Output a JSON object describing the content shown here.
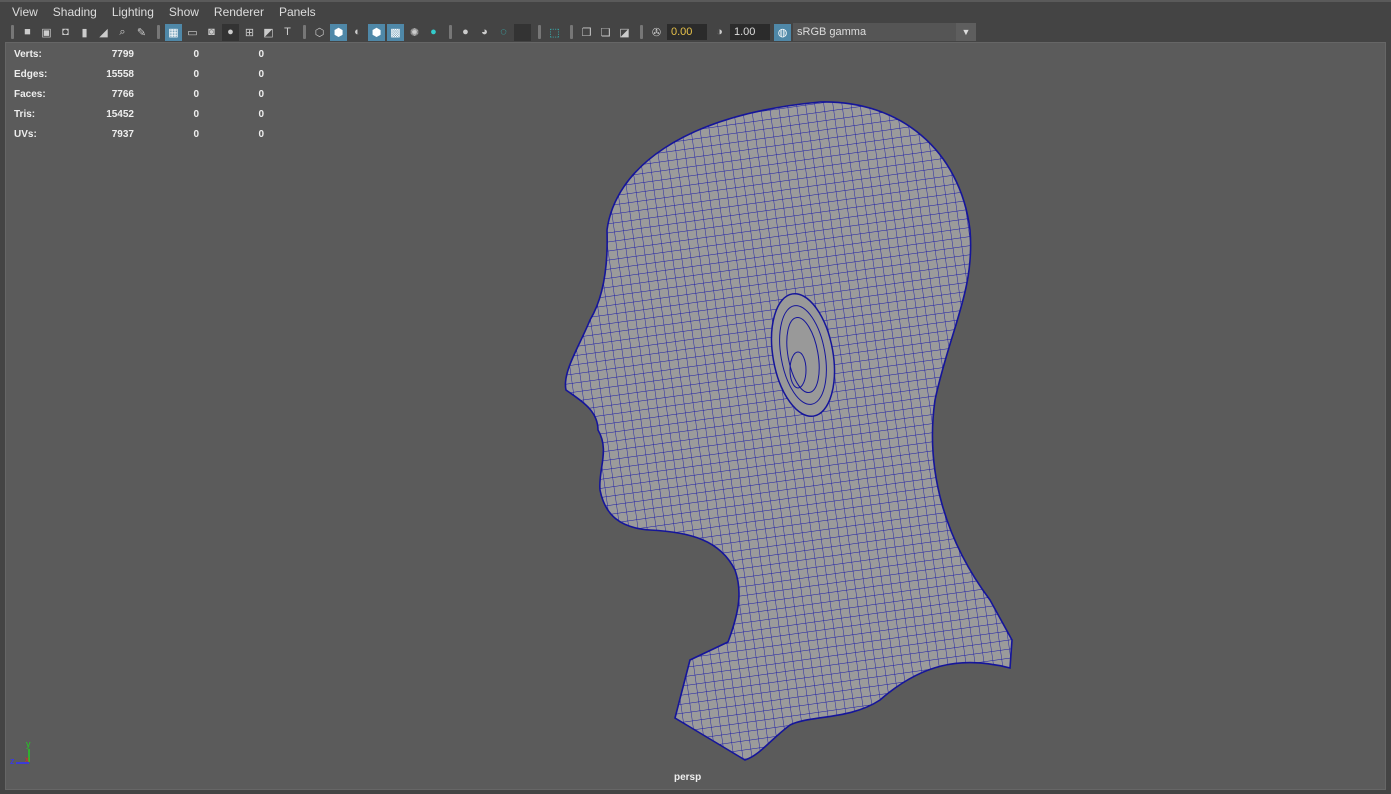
{
  "menu": [
    "View",
    "Shading",
    "Lighting",
    "Show",
    "Renderer",
    "Panels"
  ],
  "toolbar": {
    "exposure": "0.00",
    "gamma": "1.00",
    "color_management": "sRGB gamma",
    "icons": [
      "camera-icon",
      "lock-camera-icon",
      "camera-attributes-icon",
      "bookmark-icon",
      "image-plane-icon",
      "two-d-pan-zoom-icon",
      "grease-pencil-icon",
      "grid-icon",
      "film-gate-icon",
      "resolution-gate-icon",
      "gate-mask-icon",
      "field-chart-icon",
      "safe-action-icon",
      "safe-title-icon",
      "wireframe-icon",
      "smooth-shade-icon",
      "default-material-icon",
      "wireframe-on-shaded-icon",
      "textured-icon",
      "use-all-lights-icon",
      "shadows-icon",
      "screen-space-ao-icon",
      "motion-blur-icon",
      "anti-aliasing-icon",
      "depth-of-field-icon",
      "isolate-select-icon",
      "xray-icon",
      "xray-joints-icon",
      "xray-active-icon",
      "exposure-icon",
      "gamma-icon",
      "color-management-icon"
    ]
  },
  "stats": [
    {
      "label": "Verts:",
      "v1": "7799",
      "v2": "0",
      "v3": "0"
    },
    {
      "label": "Edges:",
      "v1": "15558",
      "v2": "0",
      "v3": "0"
    },
    {
      "label": "Faces:",
      "v1": "7766",
      "v2": "0",
      "v3": "0"
    },
    {
      "label": "Tris:",
      "v1": "15452",
      "v2": "0",
      "v3": "0"
    },
    {
      "label": "UVs:",
      "v1": "7937",
      "v2": "0",
      "v3": "0"
    }
  ],
  "camera": "persp",
  "axis": {
    "y": "y",
    "z": "z",
    "x": "x"
  },
  "colors": {
    "wire": "#1a1aa8",
    "mesh": "#9b9b9b",
    "viewport": "#5b5b5b",
    "accent": "#4f88a8"
  }
}
